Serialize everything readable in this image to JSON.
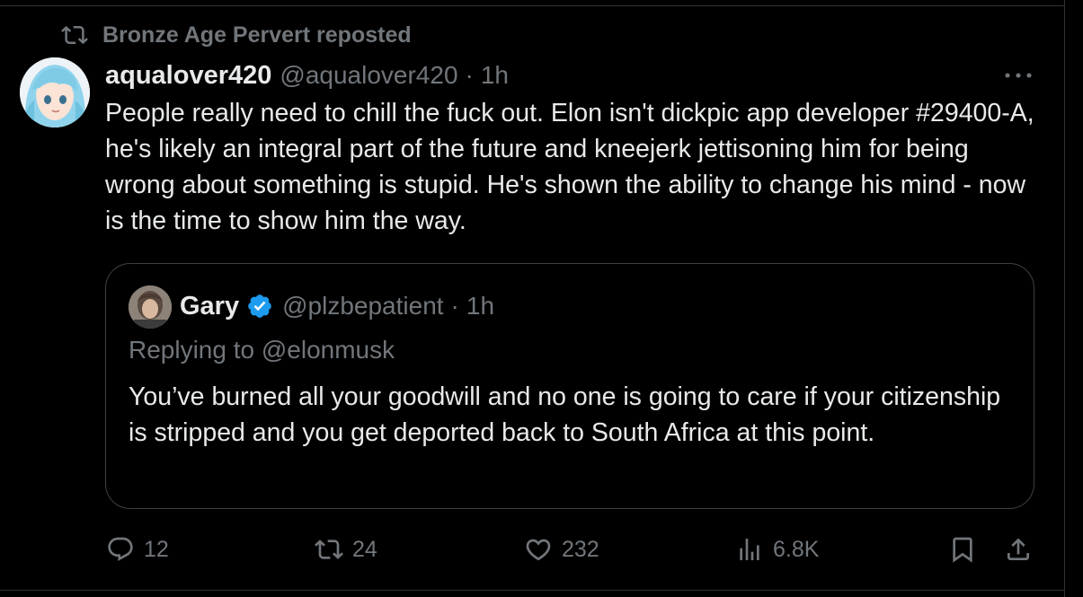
{
  "repost": {
    "label": "Bronze Age Pervert reposted",
    "icon": "repost-icon"
  },
  "tweet": {
    "display_name": "aqualover420",
    "handle": "@aqualover420",
    "separator": "·",
    "time": "1h",
    "more_icon": "more-icon",
    "text": "People really need to chill the fuck out. Elon isn't dickpic app developer #29400-A, he's likely an integral part of the future and kneejerk jettisoning him for being wrong about something is stupid. He's shown the ability to change his mind - now is the time to show him the way."
  },
  "quote": {
    "display_name": "Gary",
    "verified": true,
    "handle": "@plzbepatient",
    "separator": "·",
    "time": "1h",
    "replying_prefix": "Replying to ",
    "replying_to": "@elonmusk",
    "text": "You’ve burned all your goodwill and no one is going to care if your citizenship is stripped and you get deported back to South Africa at this point."
  },
  "actions": {
    "replies": "12",
    "reposts": "24",
    "likes": "232",
    "views": "6.8K"
  },
  "colors": {
    "background": "#000000",
    "text": "#e7e9ea",
    "muted": "#71767b",
    "border": "#2f3336",
    "verified_blue": "#1d9bf0"
  }
}
